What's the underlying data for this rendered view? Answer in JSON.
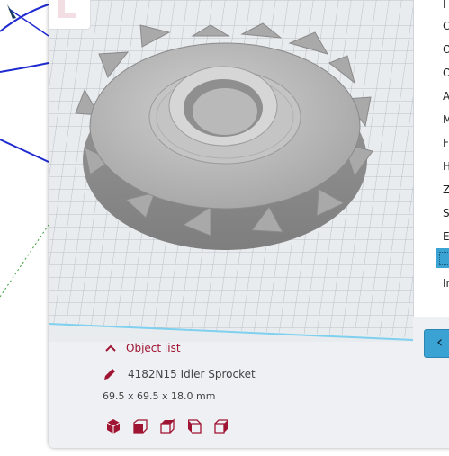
{
  "side_panel": {
    "items": [
      {
        "label": "I"
      },
      {
        "label": "C"
      },
      {
        "label": "O"
      },
      {
        "label": "O"
      },
      {
        "label": "A"
      },
      {
        "label": "M"
      },
      {
        "label": "F"
      },
      {
        "label": "H"
      },
      {
        "label": "Z"
      },
      {
        "label": "S"
      },
      {
        "label": "E"
      },
      {
        "label": ""
      },
      {
        "label": "In"
      }
    ],
    "selected_index": 11
  },
  "object_info": {
    "list_toggle_label": "Object list",
    "object_name": "4182N15 Idler Sprocket",
    "dimensions": "69.5 x 69.5 x 18.0 mm"
  },
  "view_buttons": [
    {
      "icon": "3d-view-icon"
    },
    {
      "icon": "front-view-icon"
    },
    {
      "icon": "top-view-icon"
    },
    {
      "icon": "left-view-icon"
    },
    {
      "icon": "right-view-icon"
    }
  ],
  "colors": {
    "accent": "#a01433",
    "selection": "#3aa3d4",
    "model_grey": "#a6a6a6",
    "wire_blue": "#1f2bd0"
  }
}
